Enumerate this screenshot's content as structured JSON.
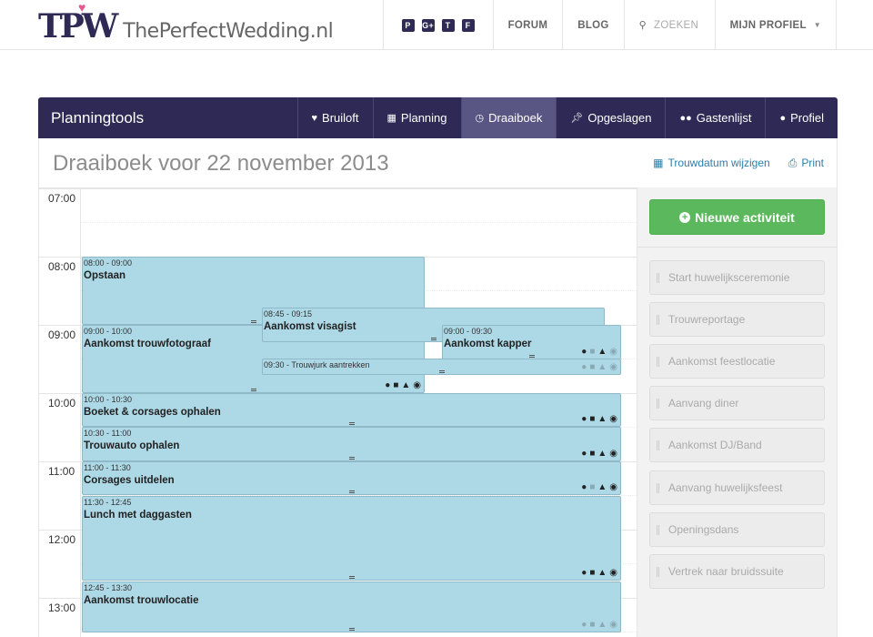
{
  "brand": {
    "mark": "TPW",
    "name": "ThePerfectWedding.nl"
  },
  "topnav": {
    "social": [
      "p",
      "g+",
      "t",
      "f"
    ],
    "forum": "FORUM",
    "blog": "BLOG",
    "search_placeholder": "ZOEKEN",
    "profile": "MIJN PROFIEL"
  },
  "toolbar": {
    "title": "Planningtools",
    "tabs": [
      {
        "label": "Bruiloft",
        "icon": "heart-icon"
      },
      {
        "label": "Planning",
        "icon": "calendar-icon"
      },
      {
        "label": "Draaiboek",
        "icon": "clock-icon"
      },
      {
        "label": "Opgeslagen",
        "icon": "pin-icon"
      },
      {
        "label": "Gastenlijst",
        "icon": "users-icon"
      },
      {
        "label": "Profiel",
        "icon": "user-icon"
      }
    ],
    "active": "Draaiboek"
  },
  "page": {
    "title": "Draaiboek voor  22 november 2013",
    "change_date": "Trouwdatum wijzigen",
    "print": "Print"
  },
  "calendar": {
    "hours": [
      "07:00",
      "08:00",
      "09:00",
      "10:00",
      "11:00",
      "12:00",
      "13:00"
    ],
    "events": [
      {
        "time": "08:00 - 09:00",
        "name": "Opstaan"
      },
      {
        "time": "08:45 - 09:15",
        "name": "Aankomst visagist"
      },
      {
        "time": "09:00 - 09:30",
        "name": "Aankomst kapper"
      },
      {
        "time": "09:00 - 10:00",
        "name": "Aankomst trouwfotograaf"
      },
      {
        "time": "09:30 - Trouwjurk aantrekken",
        "name": ""
      },
      {
        "time": "10:00 - 10:30",
        "name": "Boeket & corsages ophalen"
      },
      {
        "time": "10:30 - 11:00",
        "name": "Trouwauto ophalen"
      },
      {
        "time": "11:00 - 11:30",
        "name": "Corsages uitdelen"
      },
      {
        "time": "11:30 - 12:45",
        "name": "Lunch met daggasten"
      },
      {
        "time": "12:45 - 13:30",
        "name": "Aankomst trouwlocatie"
      }
    ]
  },
  "sidebar": {
    "new_button": "Nieuwe activiteit",
    "activities": [
      "Start huwelijksceremonie",
      "Trouwreportage",
      "Aankomst feestlocatie",
      "Aanvang diner",
      "Aankomst DJ/Band",
      "Aanvang huwelijksfeest",
      "Openingsdans",
      "Vertrek naar bruidssuite"
    ]
  },
  "colors": {
    "navy": "#2e2a55",
    "green": "#5cb85c",
    "event": "#add8e6",
    "link": "#2a7fa8"
  }
}
